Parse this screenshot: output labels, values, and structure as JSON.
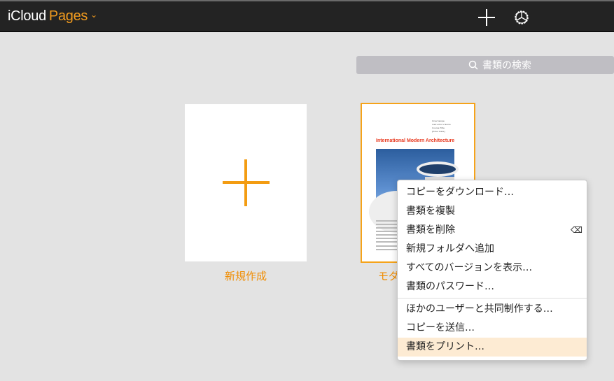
{
  "header": {
    "brand": "iCloud",
    "app": "Pages",
    "app_menu_chevron": "⌄",
    "new_icon": "plus-icon",
    "settings_icon": "gear-icon"
  },
  "search": {
    "placeholder": "書類の検索",
    "icon": "search-icon"
  },
  "new_document": {
    "label": "新規作成"
  },
  "document": {
    "name": "モダ",
    "thumbnail": {
      "title": "International Modern Architecture",
      "meta": [
        "Ursa Swope",
        "Instructor's Name",
        "Course Title",
        "[Enter Date]"
      ]
    }
  },
  "context_menu": {
    "items": [
      {
        "label": "コピーをダウンロード…"
      },
      {
        "label": "書類を複製"
      },
      {
        "label": "書類を削除",
        "shortcut": "⌫"
      },
      {
        "label": "新規フォルダへ追加"
      },
      {
        "label": "すべてのバージョンを表示…"
      },
      {
        "label": "書類のパスワード…"
      },
      {
        "label": "ほかのユーザーと共同制作する…"
      },
      {
        "label": "コピーを送信…"
      },
      {
        "label": "書類をプリント…",
        "highlighted": true
      }
    ]
  },
  "colors": {
    "accent": "#f08c00",
    "topbar": "#232323",
    "background": "#e3e3e3"
  }
}
